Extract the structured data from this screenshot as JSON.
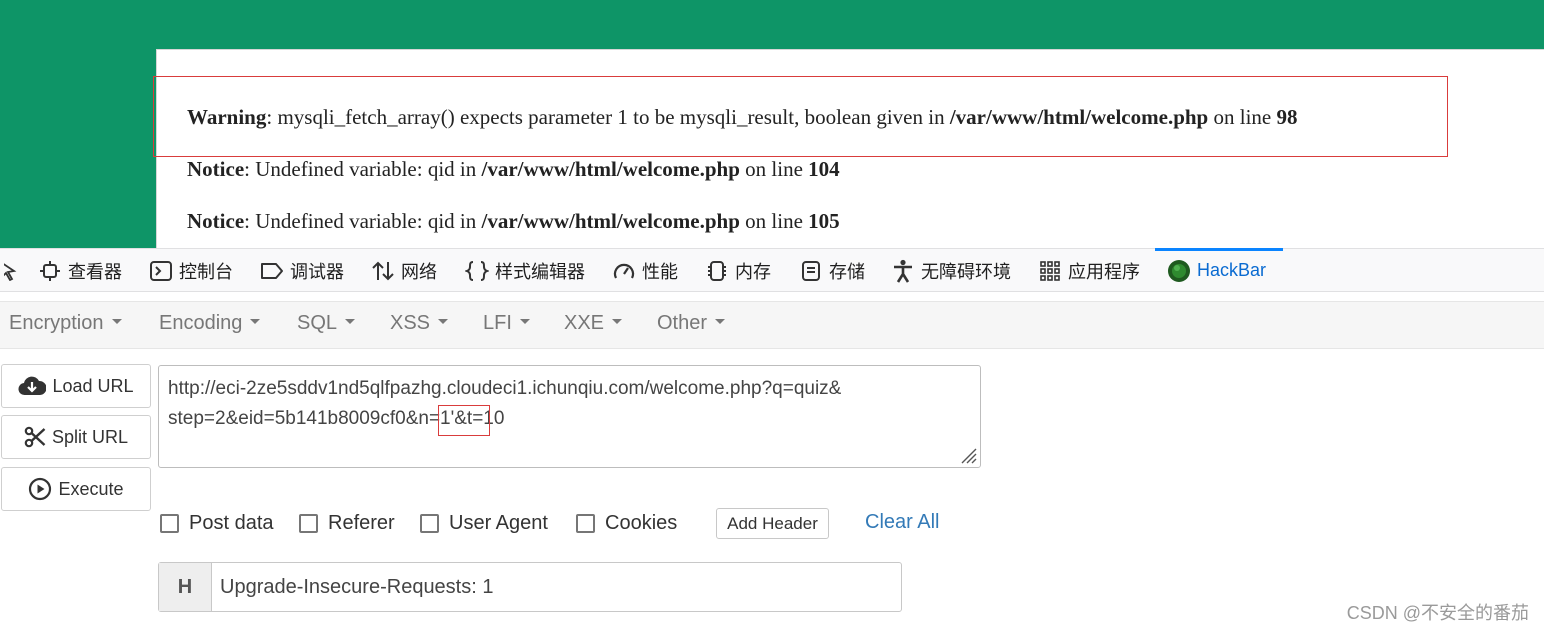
{
  "page": {
    "messages": [
      {
        "level": "Warning",
        "text": ": mysqli_fetch_array() expects parameter 1 to be mysqli_result, boolean given in ",
        "file": "/var/www/html/welcome.php",
        "line_text": " on line ",
        "line": "98"
      },
      {
        "level": "Notice",
        "text": ": Undefined variable: qid in ",
        "file": "/var/www/html/welcome.php",
        "line_text": " on line ",
        "line": "104"
      },
      {
        "level": "Notice",
        "text": ": Undefined variable: qid in ",
        "file": "/var/www/html/welcome.php",
        "line_text": " on line ",
        "line": "105"
      }
    ],
    "background_color": "#0e9567"
  },
  "devtools": {
    "tabs": [
      {
        "label": "查看器",
        "icon": "inspector-icon"
      },
      {
        "label": "控制台",
        "icon": "console-icon"
      },
      {
        "label": "调试器",
        "icon": "debugger-icon"
      },
      {
        "label": "网络",
        "icon": "network-icon"
      },
      {
        "label": "样式编辑器",
        "icon": "style-editor-icon"
      },
      {
        "label": "性能",
        "icon": "performance-icon"
      },
      {
        "label": "内存",
        "icon": "memory-icon"
      },
      {
        "label": "存储",
        "icon": "storage-icon"
      },
      {
        "label": "无障碍环境",
        "icon": "accessibility-icon"
      },
      {
        "label": "应用程序",
        "icon": "application-icon"
      },
      {
        "label": "HackBar",
        "icon": "hackbar-icon",
        "active": true
      }
    ],
    "accent_color": "#0a84ff"
  },
  "hackbar": {
    "menu": [
      "Encryption",
      "Encoding",
      "SQL",
      "XSS",
      "LFI",
      "XXE",
      "Other"
    ],
    "buttons": {
      "load": "Load URL",
      "split": "Split URL",
      "execute": "Execute"
    },
    "url": {
      "line1": "http://eci-2ze5sddv1nd5qlfpazhg.cloudeci1.ichunqiu.com/welcome.php?q=quiz&",
      "line2": "step=2&eid=5b141b8009cf0&n=1'&t=10"
    },
    "options": {
      "post_data": "Post data",
      "referer": "Referer",
      "user_agent": "User Agent",
      "cookies": "Cookies"
    },
    "add_header": "Add Header",
    "clear_all": "Clear All",
    "header": {
      "addon": "H",
      "value": "Upgrade-Insecure-Requests: 1"
    }
  },
  "watermark": "CSDN @不安全的番茄"
}
